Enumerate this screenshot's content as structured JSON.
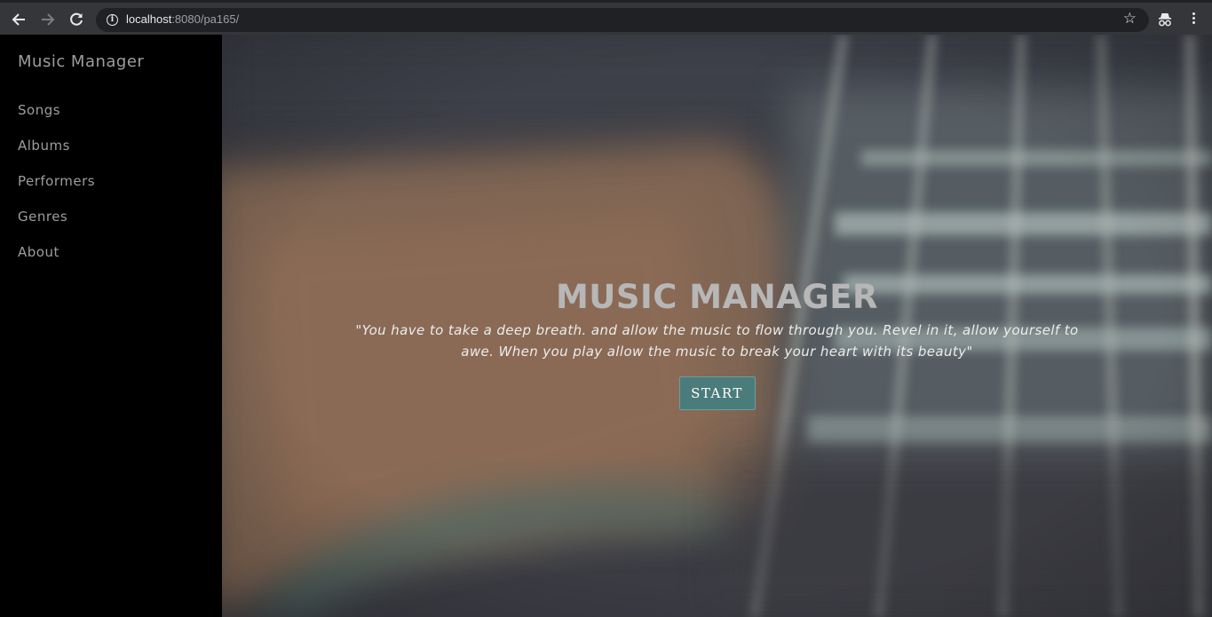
{
  "browser": {
    "url_host": "localhost",
    "url_rest": ":8080/pa165/",
    "icons": [
      "back-arrow-icon",
      "forward-arrow-icon",
      "reload-icon",
      "info-icon",
      "star-icon",
      "incognito-icon",
      "menu-icon"
    ]
  },
  "sidebar": {
    "brand": "Music Manager",
    "items": [
      {
        "label": "Songs"
      },
      {
        "label": "Albums"
      },
      {
        "label": "Performers"
      },
      {
        "label": "Genres"
      },
      {
        "label": "About"
      }
    ]
  },
  "hero": {
    "title": "MUSIC MANAGER",
    "quote": "\"You have to take a deep breath. and allow the music to flow through you. Revel in it, allow yourself to awe. When you play allow the music to break your heart with its beauty\"",
    "button_label": "START"
  },
  "colors": {
    "sidebar_bg": "#000000",
    "nav_text": "#9d9d9d",
    "button_bg": "#4a7c7b",
    "title_text": "#b7b7b8"
  }
}
